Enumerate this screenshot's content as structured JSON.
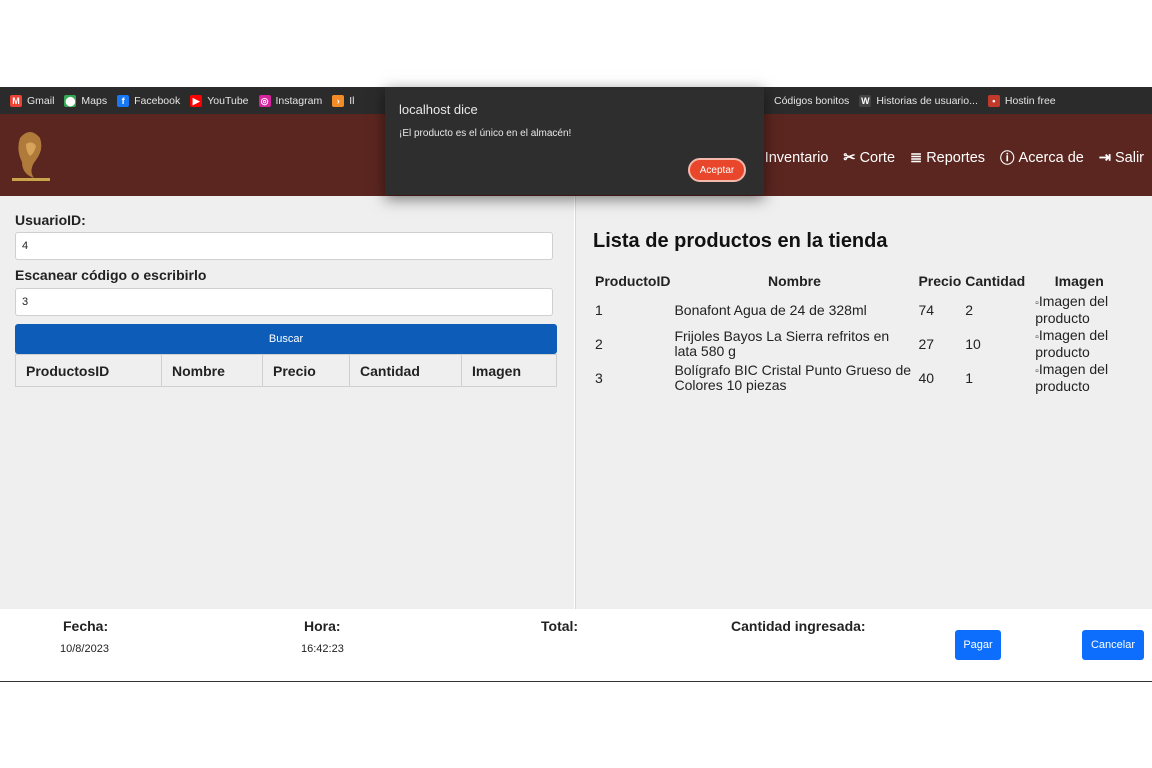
{
  "bookmarks": [
    {
      "label": "Gmail",
      "icon": "gmail-icon",
      "color": "#ea4335",
      "glyph": "M"
    },
    {
      "label": "Maps",
      "icon": "maps-icon",
      "color": "#34a853",
      "glyph": "⬤"
    },
    {
      "label": "Facebook",
      "icon": "facebook-icon",
      "color": "#1877f2",
      "glyph": "f"
    },
    {
      "label": "YouTube",
      "icon": "youtube-icon",
      "color": "#ff0000",
      "glyph": "▶"
    },
    {
      "label": "Instagram",
      "icon": "instagram-icon",
      "color": "#d6249f",
      "glyph": "◎"
    },
    {
      "label": "Il",
      "icon": "bookmark-icon",
      "color": "#f28c28",
      "glyph": "›"
    }
  ],
  "bookmarks_right": [
    {
      "label": "Códigos bonitos",
      "icon": "",
      "color": "",
      "glyph": ""
    },
    {
      "label": "Historias de usuario...",
      "icon": "w-icon",
      "color": "#444444",
      "glyph": "W"
    },
    {
      "label": "Hostin free",
      "icon": "hosting-icon",
      "color": "#c0392b",
      "glyph": "•"
    }
  ],
  "nav": [
    {
      "label": "Inventario",
      "icon": "inventory-icon",
      "glyph": "▮"
    },
    {
      "label": "Corte",
      "icon": "scissors-icon",
      "glyph": "✂"
    },
    {
      "label": "Reportes",
      "icon": "reports-icon",
      "glyph": "≣"
    },
    {
      "label": "Acerca de",
      "icon": "info-icon",
      "glyph": "ⓘ"
    },
    {
      "label": "Salir",
      "icon": "logout-icon",
      "glyph": "⇥"
    }
  ],
  "left": {
    "usuario_label": "UsuarioID:",
    "usuario_value": "4",
    "scan_label": "Escanear código o escribirlo",
    "scan_value": "3",
    "buscar_label": "Buscar",
    "headers": [
      "ProductosID",
      "Nombre",
      "Precio",
      "Cantidad",
      "Imagen"
    ]
  },
  "right": {
    "title": "Lista de productos en la tienda",
    "headers": [
      "ProductoID",
      "Nombre",
      "Precio",
      "Cantidad",
      "Imagen"
    ],
    "rows": [
      {
        "id": "1",
        "nombre": "Bonafont Agua de 24 de 328ml",
        "precio": "74",
        "cantidad": "2",
        "imagen": "Imagen del producto"
      },
      {
        "id": "2",
        "nombre": "Frijoles Bayos La Sierra refritos en lata 580 g",
        "precio": "27",
        "cantidad": "10",
        "imagen": "Imagen del producto"
      },
      {
        "id": "3",
        "nombre": "Bolígrafo BIC Cristal Punto Grueso de Colores 10 piezas",
        "precio": "40",
        "cantidad": "1",
        "imagen": "Imagen del producto"
      }
    ]
  },
  "footer": {
    "fecha_label": "Fecha:",
    "fecha_value": "10/8/2023",
    "hora_label": "Hora:",
    "hora_value": "16:42:23",
    "total_label": "Total:",
    "cantidad_label": "Cantidad ingresada:",
    "pagar_label": "Pagar",
    "cancelar_label": "Cancelar"
  },
  "dialog": {
    "title": "localhost dice",
    "message": "¡El producto es el único en el almacén!",
    "accept_label": "Aceptar"
  },
  "colors": {
    "navbar": "#5c2620",
    "primary": "#0d6efd",
    "buscar": "#0d5db8",
    "accept": "#e8472b"
  }
}
